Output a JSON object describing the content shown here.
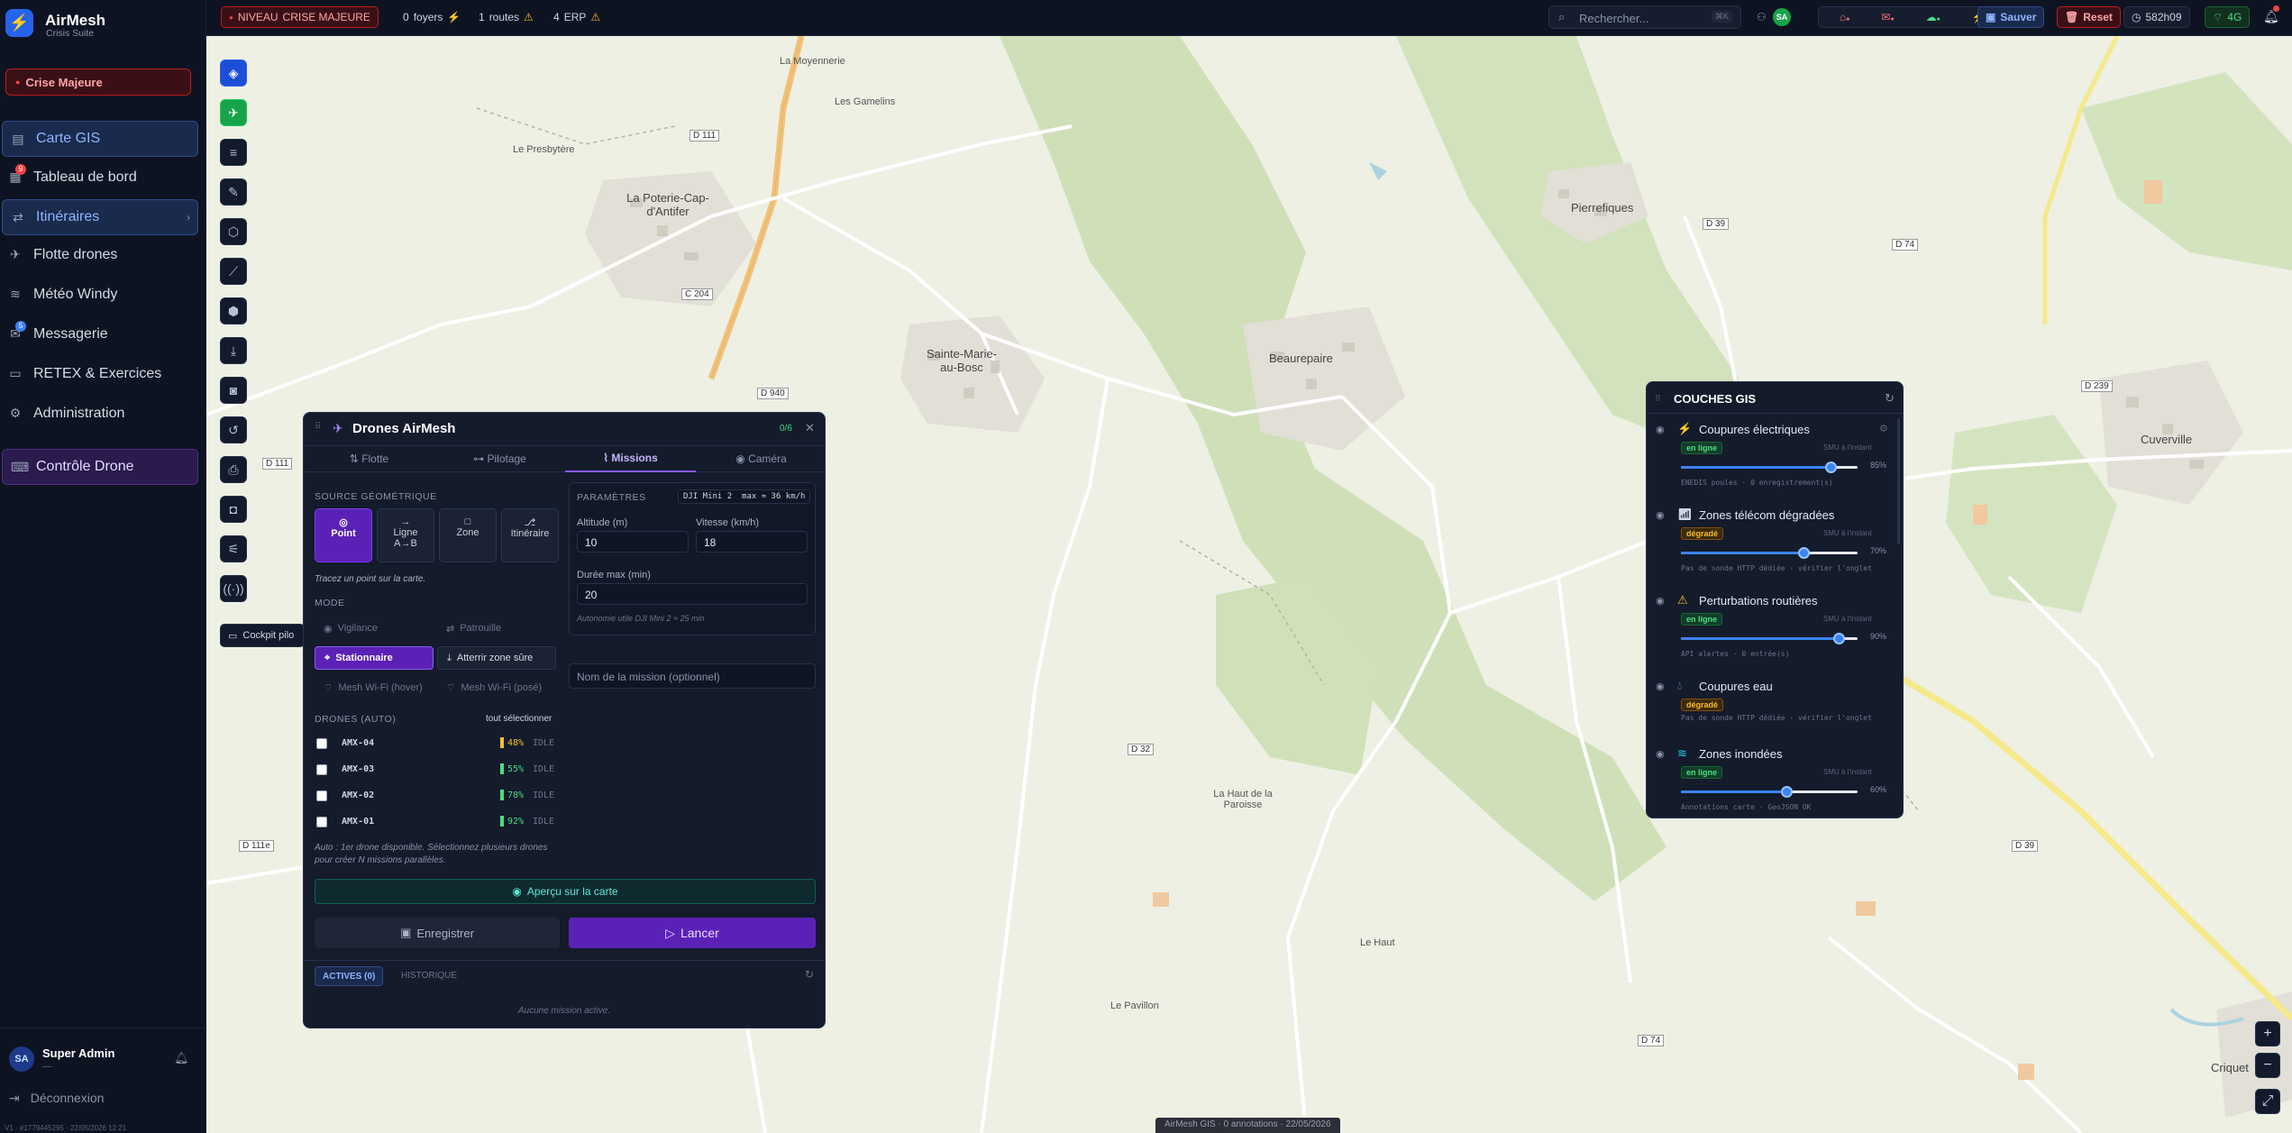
{
  "app": {
    "title": "AirMesh",
    "subtitle": "Crisis Suite",
    "crisis_button": "Crise Majeure"
  },
  "sidebar": {
    "items": [
      {
        "label": "Carte GIS",
        "icon": "map-icon"
      },
      {
        "label": "Tableau de bord",
        "icon": "dashboard-icon",
        "badge": "9"
      },
      {
        "label": "Itinéraires",
        "icon": "route-icon"
      },
      {
        "label": "Flotte drones",
        "icon": "drone-icon"
      },
      {
        "label": "Météo Windy",
        "icon": "wind-icon"
      },
      {
        "label": "Messagerie",
        "icon": "message-icon",
        "badge": "5"
      },
      {
        "label": "RETEX & Exercices",
        "icon": "book-icon"
      },
      {
        "label": "Administration",
        "icon": "gear-icon"
      },
      {
        "label": "Contrôle Drone",
        "icon": "controller-icon"
      }
    ],
    "user": {
      "initials": "SA",
      "name": "Super Admin",
      "role": "—"
    },
    "logout": "Déconnexion",
    "version": "V1 · #1779445295 · 22/05/2026 12:21"
  },
  "topbar": {
    "level_label": "NIVEAU",
    "level_value": "CRISE MAJEURE",
    "foyers_count": "0",
    "foyers_label": "foyers",
    "routes_count": "1",
    "routes_label": "routes",
    "erp_count": "4",
    "erp_label": "ERP",
    "search_placeholder": "Rechercher...",
    "search_shortcut": "⌘K",
    "presence_initials": "SA",
    "save": "Sauver",
    "reset": "Reset",
    "time": "582h09",
    "network": "4G"
  },
  "rail": {
    "cockpit_label": "Cockpit pilo"
  },
  "map": {
    "labels": [
      "La Moyennerie",
      "Les Gamelins",
      "Le Presbytère",
      "D 111",
      "La Poterie-Cap-d'Antifer",
      "Pierrefiques",
      "D 39",
      "D 74",
      "C 204",
      "Sainte-Marie-au-Bosc",
      "D 940",
      "Beaurepaire",
      "Cuverville",
      "D 239",
      "D 111",
      "D 32",
      "La Haut de la Paroisse",
      "Le Haut",
      "Le Pavillon",
      "D 74",
      "D 111e",
      "D 39",
      "Criquet"
    ],
    "footer": "AirMesh GIS · 0 annotations · 22/05/2026"
  },
  "drone_panel": {
    "title": "Drones AirMesh",
    "count": "0/6",
    "tabs": [
      "Flotte",
      "Pilotage",
      "Missions",
      "Caméra"
    ],
    "source_label": "SOURCE GÉOMÉTRIQUE",
    "geo": [
      {
        "label": "Point",
        "icon": "◎"
      },
      {
        "label": "Ligne A→B",
        "icon": "→"
      },
      {
        "label": "Zone",
        "icon": "□"
      },
      {
        "label": "Itinéraire",
        "icon": "⎇"
      }
    ],
    "hint": "Tracez un point sur la carte.",
    "mode_label": "MODE",
    "modes": [
      "Vigilance",
      "Patrouille",
      "Stationnaire",
      "Atterrir zone sûre",
      "Mesh Wi-Fi (hover)",
      "Mesh Wi-Fi (posé)"
    ],
    "drones_label": "DRONES (AUTO)",
    "select_all": "tout sélectionner",
    "drones": [
      {
        "name": "AMX-04",
        "battery": "48%",
        "state": "IDLE",
        "color": "#fbbf24"
      },
      {
        "name": "AMX-03",
        "battery": "55%",
        "state": "IDLE",
        "color": "#4ade80"
      },
      {
        "name": "AMX-02",
        "battery": "78%",
        "state": "IDLE",
        "color": "#4ade80"
      },
      {
        "name": "AMX-01",
        "battery": "92%",
        "state": "IDLE",
        "color": "#4ade80"
      }
    ],
    "auto_note": "Auto : 1er drone disponible. Sélectionnez plusieurs drones pour créer N missions parallèles.",
    "params_label": "PARAMÈTRES",
    "params_model": "DJI Mini 2",
    "params_max": "max ≈ 36 km/h",
    "altitude_label": "Altitude (m)",
    "altitude": "10",
    "speed_label": "Vitesse (km/h)",
    "speed": "18",
    "duration_label": "Durée max (min)",
    "duration": "20",
    "autonomy": "Autonomie utile DJI Mini 2 ≈ 25 min",
    "mission_name_placeholder": "Nom de la mission (optionnel)",
    "preview": "Aperçu sur la carte",
    "save": "Enregistrer",
    "launch": "Lancer",
    "active_tab": "ACTIVES (0)",
    "history_tab": "HISTORIQUE",
    "empty": "Aucune mission active."
  },
  "gis_panel": {
    "title": "COUCHES GIS",
    "layers": [
      {
        "name": "Coupures électriques",
        "status": "en ligne",
        "type": "ok",
        "value": "85%",
        "note": "ENEDIS poules · 0 enregistrement(s)",
        "meta": "SMU à l'instant",
        "fill": 0.85
      },
      {
        "name": "Zones télécom dégradées",
        "status": "dégradé",
        "type": "deg",
        "value": "70%",
        "note": "Pas de sonde HTTP dédiée · vérifier l'onglet",
        "meta": "SMU à l'instant",
        "fill": 0.7
      },
      {
        "name": "Perturbations routières",
        "status": "en ligne",
        "type": "ok",
        "value": "90%",
        "note": "API alertes · 0 entrée(s)",
        "meta": "SMU à l'instant",
        "fill": 0.9
      },
      {
        "name": "Coupures eau",
        "status": "dégradé",
        "type": "deg",
        "value": "",
        "note": "Pas de sonde HTTP dédiée · vérifier l'onglet",
        "meta": "",
        "fill": 0
      },
      {
        "name": "Zones inondées",
        "status": "en ligne",
        "type": "ok",
        "value": "60%",
        "note": "Annotations carte · GeoJSON OK",
        "meta": "SMU à l'instant",
        "fill": 0.6
      }
    ]
  },
  "colors": {
    "accent": "#2563eb",
    "purple": "#5b21b6",
    "danger": "#b91c1c",
    "ok": "#4ade80",
    "warn": "#fbbf24"
  }
}
